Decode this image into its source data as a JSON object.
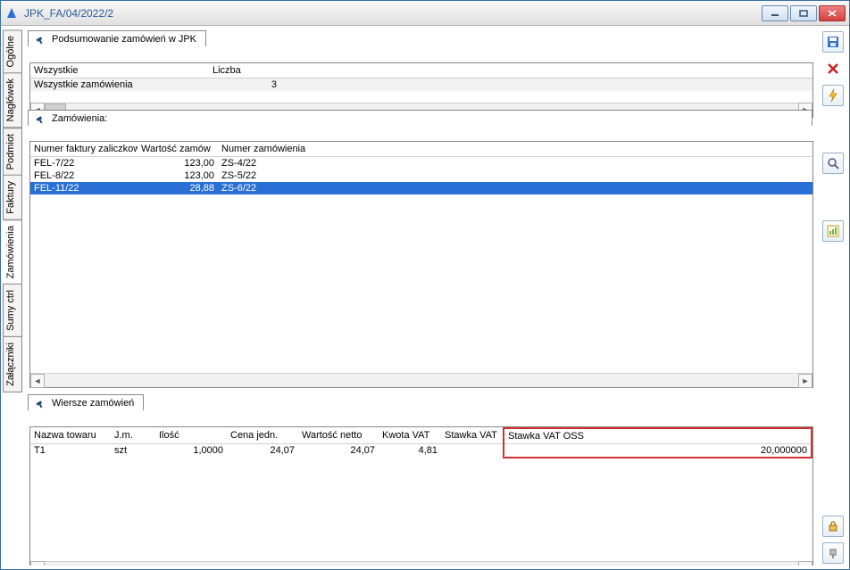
{
  "window": {
    "title": "JPK_FA/04/2022/2"
  },
  "tabs": [
    {
      "label": "Ogólne"
    },
    {
      "label": "Nagłówek"
    },
    {
      "label": "Podmiot"
    },
    {
      "label": "Faktury"
    },
    {
      "label": "Zamówienia",
      "active": true
    },
    {
      "label": "Sumy ctrl"
    },
    {
      "label": "Załączniki"
    }
  ],
  "summary": {
    "title": "Podsumowanie zamówień w JPK",
    "headers": [
      "Wszystkie",
      "Liczba"
    ],
    "rows": [
      {
        "c0": "Wszystkie zamówienia",
        "c1": "3"
      }
    ]
  },
  "orders": {
    "title": "Zamówienia:",
    "headers": [
      "Numer faktury zaliczkow",
      "Wartość zamów",
      "Numer zamówienia"
    ],
    "rows": [
      {
        "c0": "FEL-7/22",
        "c1": "123,00",
        "c2": "ZS-4/22"
      },
      {
        "c0": "FEL-8/22",
        "c1": "123,00",
        "c2": "ZS-5/22"
      },
      {
        "c0": "FEL-11/22",
        "c1": "28,88",
        "c2": "ZS-6/22",
        "selected": true
      }
    ]
  },
  "lines": {
    "title": "Wiersze zamówień",
    "headers": [
      "Nazwa towaru",
      "J.m.",
      "Ilość",
      "Cena jedn.",
      "Wartość netto",
      "Kwota VAT",
      "Stawka VAT",
      "Stawka VAT OSS"
    ],
    "rows": [
      {
        "c0": "T1",
        "c1": "szt",
        "c2": "1,0000",
        "c3": "24,07",
        "c4": "24,07",
        "c5": "4,81",
        "c6": "",
        "c7": "20,000000"
      }
    ]
  },
  "toolbar": {
    "save": "save-icon",
    "delete": "delete-icon",
    "bolt": "bolt-icon",
    "preview": "preview-icon",
    "chart": "chart-icon",
    "lock": "lock-icon",
    "misc": "misc-icon"
  }
}
